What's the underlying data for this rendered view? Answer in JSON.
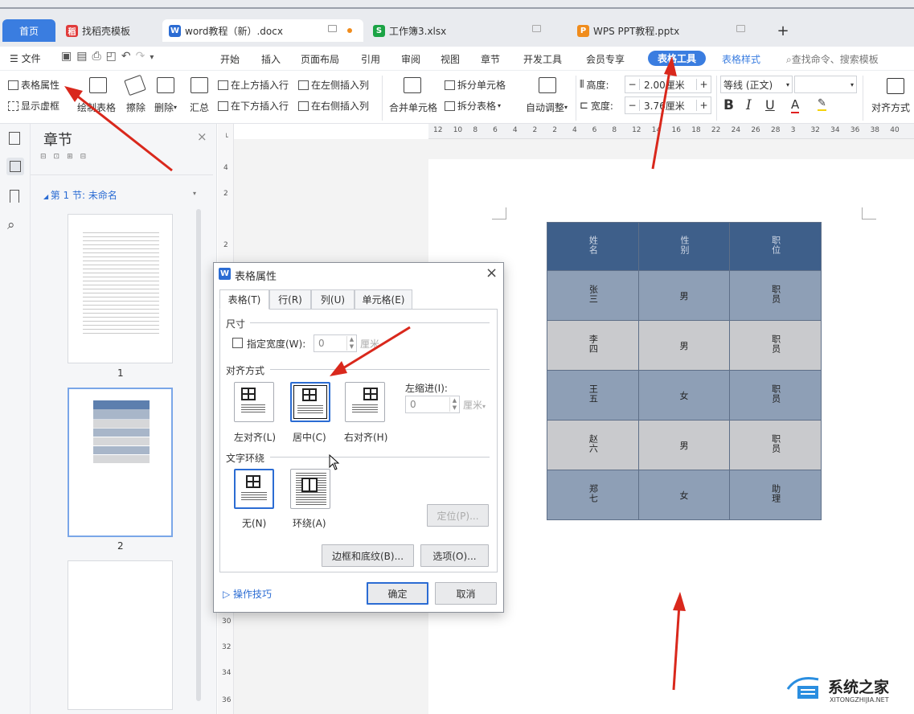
{
  "tabs": [
    {
      "label": "首页",
      "icon": ""
    },
    {
      "label": "找稻壳模板",
      "icon": "稻"
    },
    {
      "label": "word教程（新）.docx",
      "icon": "W"
    },
    {
      "label": "工作簿3.xlsx",
      "icon": "S"
    },
    {
      "label": "WPS PPT教程.pptx",
      "icon": "P"
    },
    {
      "label": "+",
      "icon": ""
    }
  ],
  "colors": {
    "accent": "#3a7de0",
    "wps_red": "#e03b3b",
    "word_blue": "#2b6cd3",
    "excel_green": "#1ba345",
    "ppt_orange": "#f08c1c",
    "table_header": "#3e5f8a",
    "table_body_blue": "#8e9fb6",
    "table_body_gray": "#c9cacd",
    "arrow_red": "#d9281c"
  },
  "menu": {
    "file": "文件",
    "items": [
      "开始",
      "插入",
      "页面布局",
      "引用",
      "审阅",
      "视图",
      "章节",
      "开发工具",
      "会员专享"
    ],
    "active": "表格工具",
    "table_style": "表格样式",
    "search": "查找命令、搜索模板"
  },
  "ribbon": {
    "table_props": "表格属性",
    "show_grid": "显示虚框",
    "draw_table": "绘制表格",
    "erase": "擦除",
    "delete": "删除",
    "summary": "汇总",
    "insert_above": "在上方插入行",
    "insert_below": "在下方插入行",
    "insert_left": "在左侧插入列",
    "insert_right": "在右侧插入列",
    "merge_cells": "合并单元格",
    "split_cells": "拆分单元格",
    "split_table": "拆分表格",
    "auto_fit": "自动调整",
    "height_label": "高度:",
    "height_value": "2.00厘米",
    "width_label": "宽度:",
    "width_value": "3.76厘米",
    "font_name": "等线 (正文)",
    "font_size": "",
    "align_mode": "对齐方式",
    "minus": "−",
    "plus": "+"
  },
  "nav": {
    "title": "章节",
    "section": "第 1 节: 未命名",
    "pages": [
      "1",
      "2"
    ]
  },
  "ruler": {
    "h_ticks": [
      "12",
      "10",
      "8",
      "6",
      "4",
      "2",
      "2",
      "4",
      "6",
      "8",
      "12",
      "14",
      "16",
      "18",
      "22",
      "24",
      "26",
      "28",
      "3",
      "32",
      "34",
      "36",
      "38",
      "40"
    ],
    "v_ticks": [
      "4",
      "2",
      "2",
      "30",
      "32",
      "34",
      "36"
    ]
  },
  "doc_table": {
    "header": [
      "姓名",
      "性别",
      "职位"
    ],
    "rows": [
      [
        "张三",
        "男",
        "职员"
      ],
      [
        "李四",
        "男",
        "职员"
      ],
      [
        "王五",
        "女",
        "职员"
      ],
      [
        "赵六",
        "男",
        "职员"
      ],
      [
        "郑七",
        "女",
        "助理"
      ]
    ]
  },
  "dialog": {
    "title": "表格属性",
    "tabs": [
      "表格(T)",
      "行(R)",
      "列(U)",
      "单元格(E)"
    ],
    "size_section": "尺寸",
    "specify_width": "指定宽度(W):",
    "width_value": "0",
    "width_unit": "厘米",
    "align_section": "对齐方式",
    "align_options": [
      "左对齐(L)",
      "居中(C)",
      "右对齐(H)"
    ],
    "left_indent": "左缩进(I):",
    "indent_value": "0",
    "indent_unit": "厘米",
    "wrap_section": "文字环绕",
    "wrap_options": [
      "无(N)",
      "环绕(A)"
    ],
    "position_btn": "定位(P)...",
    "border_btn": "边框和底纹(B)...",
    "options_btn": "选项(O)...",
    "tips": "操作技巧",
    "ok": "确定",
    "cancel": "取消"
  },
  "watermark": {
    "name": "系统之家",
    "url": "XITONGZHIJIA.NET"
  }
}
